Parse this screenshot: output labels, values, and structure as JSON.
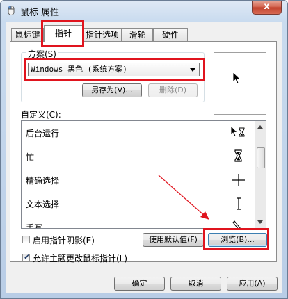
{
  "window": {
    "title": "鼠标 属性",
    "close_glyph": "x"
  },
  "tabs": [
    {
      "label": "鼠标键"
    },
    {
      "label": "指针",
      "active": true
    },
    {
      "label": "指针选项"
    },
    {
      "label": "滑轮"
    },
    {
      "label": "硬件"
    }
  ],
  "scheme": {
    "label": "方案(S)",
    "selected": "Windows 黑色 (系统方案)",
    "save_as_label": "另存为(V)...",
    "delete_label": "删除(D)"
  },
  "customize": {
    "label": "自定义(C):",
    "items": [
      {
        "label": "后台运行",
        "cursor_icon": "arrow-hourglass-icon"
      },
      {
        "label": "忙",
        "cursor_icon": "hourglass-icon"
      },
      {
        "label": "精确选择",
        "cursor_icon": "crosshair-icon"
      },
      {
        "label": "文本选择",
        "cursor_icon": "ibeam-icon"
      },
      {
        "label": "手写",
        "cursor_icon": "pen-icon"
      }
    ]
  },
  "options": {
    "shadow_label": "启用指针阴影(E)",
    "shadow_checked": false,
    "theme_label": "允许主题更改鼠标指针(L)",
    "theme_checked": true
  },
  "buttons": {
    "use_default": "使用默认值(F)",
    "browse": "浏览(B)...",
    "ok": "确定",
    "cancel": "取消",
    "apply": "应用(A)"
  },
  "colors": {
    "highlight": "#e0141e",
    "annotation_arrow": "#e0141e"
  }
}
